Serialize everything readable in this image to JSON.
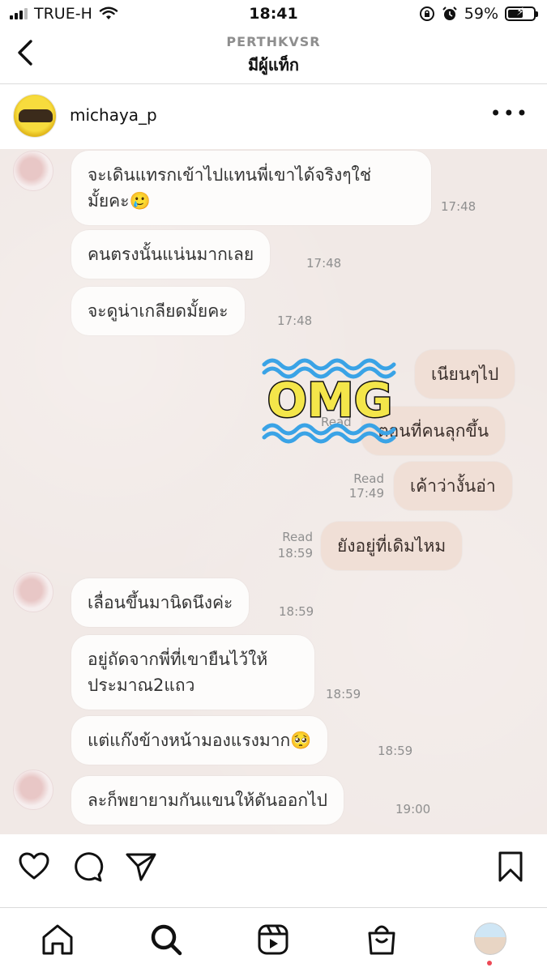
{
  "status_bar": {
    "carrier": "TRUE-H",
    "time": "18:41",
    "battery": "59%",
    "battery_level": 0.59
  },
  "header": {
    "owner": "PERTHKVSR",
    "title": "มีผู้แท็ก"
  },
  "post": {
    "username": "michaya_p"
  },
  "chat": {
    "messages": [
      {
        "text_line1": "จะเดินแทรกเข้าไปแทนพี่เขาได้จริงๆใช่",
        "text_line2": "มั้ยคะ🥲",
        "time": "17:48"
      },
      {
        "text": "คนตรงนั้นแน่นมากเลย",
        "time": "17:48"
      },
      {
        "text": "จะดูน่าเกลียดมั้ยคะ",
        "time": "17:48"
      },
      {
        "text": "เนียนๆไป",
        "time": ""
      },
      {
        "text": "ตอนที่คนลุกขึ้น",
        "read": "Read"
      },
      {
        "text": "เค้าว่างั้นอ่า",
        "read": "Read",
        "time": "17:49"
      },
      {
        "text": "ยังอยู่ที่เดิมไหม",
        "read": "Read",
        "time": "18:59"
      },
      {
        "text": "เลื่อนขึ้นมานิดนึงค่ะ",
        "time": "18:59"
      },
      {
        "text_line1": "อยู่ถัดจากพี่ที่เขายืนไว้ให้",
        "text_line2": "ประมาณ2แถว",
        "time": "18:59"
      },
      {
        "text": "แต่แก๊งข้างหน้ามองแรงมาก🥺",
        "time": "18:59"
      },
      {
        "text": "ละก็พยายามกันแขนให้ดันออกไป",
        "time": "19:00"
      }
    ],
    "sticker": "OMG"
  },
  "icons": {
    "like": "heart-icon",
    "comment": "comment-icon",
    "share": "send-icon",
    "save": "bookmark-icon",
    "home": "home-icon",
    "search": "search-icon",
    "reels": "reels-icon",
    "shop": "shop-icon"
  },
  "colors": {
    "accent": "#ed4956",
    "sticker_fill": "#f4e64a",
    "sticker_wave": "#3aa3e6"
  }
}
